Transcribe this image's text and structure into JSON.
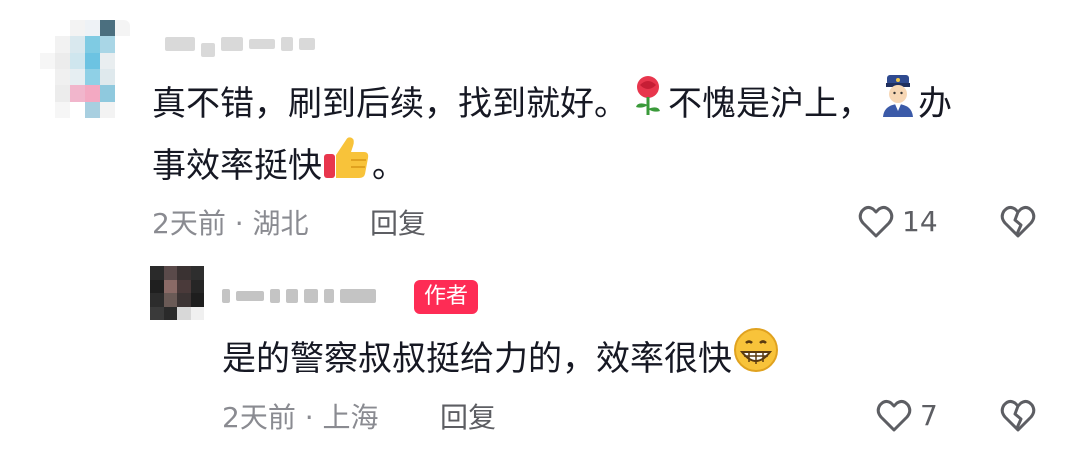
{
  "comments": [
    {
      "id": "c1",
      "text_line1_a": "真不错，刷到后续，找到就好。",
      "emoji_rose": "🌹",
      "text_line1_b": "不愧是沪上，",
      "emoji_police": "👮",
      "text_line1_c": "办",
      "text_line2_a": "事效率挺快",
      "emoji_thumb": "👍",
      "text_line2_b": "。",
      "time": "2天前",
      "separator": "·",
      "location": "湖北",
      "reply_label": "回复",
      "likes": "14",
      "icons": {
        "like": "heart-outline-icon",
        "dislike": "broken-heart-icon"
      }
    },
    {
      "id": "c2",
      "author_badge": "作者",
      "text_a": "是的警察叔叔挺给力的，效率很快",
      "emoji_grin": "😁",
      "time": "2天前",
      "separator": "·",
      "location": "上海",
      "reply_label": "回复",
      "likes": "7",
      "icons": {
        "like": "heart-outline-icon",
        "dislike": "broken-heart-icon"
      }
    }
  ],
  "colors": {
    "text": "#161823",
    "meta": "#8a8b91",
    "action": "#5d5e63",
    "badge": "#fe2c55",
    "icon": "#5d5e63"
  }
}
